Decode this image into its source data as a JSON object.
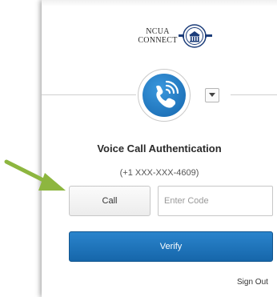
{
  "logo": {
    "line1": "NCUA",
    "line2": "CONNECT",
    "seal_icon": "ncua-seal-icon"
  },
  "factor": {
    "icon": "voice-call-phone-icon",
    "dropdown_icon": "caret-down-icon"
  },
  "auth": {
    "title": "Voice Call Authentication",
    "phone": "(+1 XXX-XXX-4609)",
    "call_label": "Call",
    "code_placeholder": "Enter Code",
    "verify_label": "Verify"
  },
  "footer": {
    "signout_label": "Sign Out"
  },
  "annotation": {
    "arrow_icon": "pointer-arrow-icon",
    "arrow_color": "#8db63f"
  },
  "colors": {
    "primary": "#1e79c2",
    "button_border": "#c7c7c7"
  }
}
